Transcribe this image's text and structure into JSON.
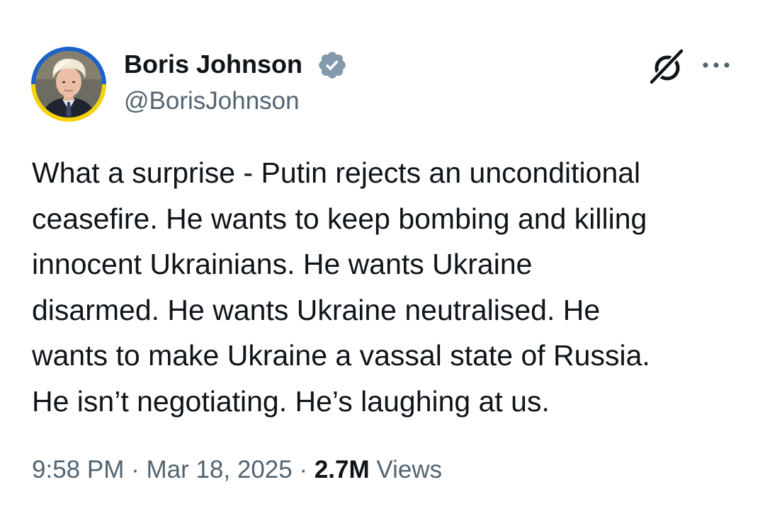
{
  "author": {
    "display_name": "Boris Johnson",
    "handle": "@BorisJohnson",
    "verified_badge_color": "#829aab",
    "avatar_ring_colors": [
      "#1b63c8",
      "#f5d20a"
    ]
  },
  "icons": {
    "verified": "verified-badge-icon",
    "grok": "grok-icon",
    "more": "more-options-icon"
  },
  "tweet": {
    "lines": [
      "What a surprise - Putin rejects an unconditional",
      "ceasefire. He wants to keep bombing and killing",
      "innocent Ukrainians. He wants Ukraine",
      "disarmed. He wants Ukraine neutralised. He",
      "wants to make Ukraine a vassal state of Russia.",
      "He isn’t negotiating. He’s laughing at us."
    ]
  },
  "meta": {
    "time": "9:58 PM",
    "separator": " · ",
    "date": "Mar 18, 2025",
    "views_count": "2.7M",
    "views_label": "Views"
  }
}
